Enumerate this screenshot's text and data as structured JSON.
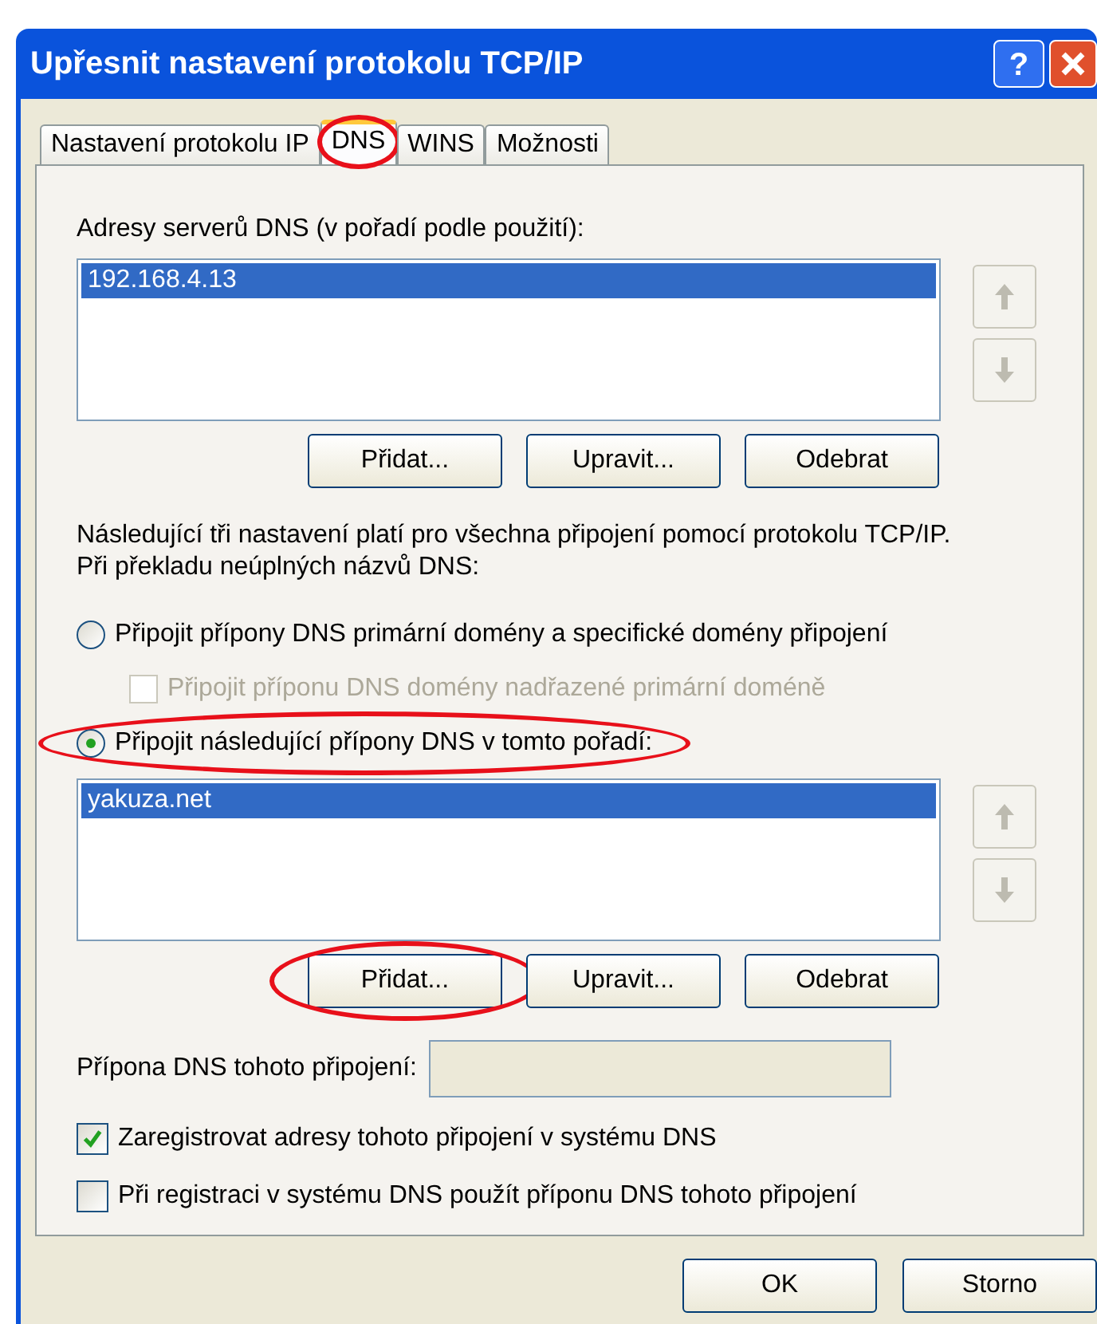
{
  "window": {
    "title": "Upřesnit nastavení protokolu TCP/IP",
    "help_label": "?"
  },
  "tabs": [
    {
      "label": "Nastavení protokolu IP",
      "selected": false,
      "highlighted": false
    },
    {
      "label": "DNS",
      "selected": true,
      "highlighted": true
    },
    {
      "label": "WINS",
      "selected": false,
      "highlighted": false
    },
    {
      "label": "Možnosti",
      "selected": false,
      "highlighted": false
    }
  ],
  "dns_servers": {
    "label": "Adresy serverů DNS (v pořadí podle použití):",
    "items": [
      {
        "text": "192.168.4.13",
        "selected": true
      }
    ],
    "buttons": [
      {
        "label": "Přidat...",
        "highlighted": false
      },
      {
        "label": "Upravit...",
        "highlighted": false
      },
      {
        "label": "Odebrat",
        "highlighted": false
      }
    ]
  },
  "note": "Následující tři nastavení platí pro všechna připojení pomocí protokolu TCP/IP. Při překladu neúplných názvů DNS:",
  "options": [
    {
      "kind": "radio",
      "label": "Připojit přípony DNS primární domény a specifické domény připojení",
      "checked": false,
      "disabled": false,
      "highlighted": false,
      "children": [
        {
          "kind": "checkbox",
          "label": "Připojit příponu DNS domény nadřazené primární doméně",
          "checked": false,
          "disabled": true,
          "highlighted": false
        }
      ]
    },
    {
      "kind": "radio",
      "label": "Připojit následující přípony DNS v tomto pořadí:",
      "checked": true,
      "disabled": false,
      "highlighted": true
    }
  ],
  "suffixes": {
    "items": [
      {
        "text": "yakuza.net",
        "selected": true
      }
    ],
    "buttons": [
      {
        "label": "Přidat...",
        "highlighted": true
      },
      {
        "label": "Upravit...",
        "highlighted": false
      },
      {
        "label": "Odebrat",
        "highlighted": false
      }
    ]
  },
  "suffix_field": {
    "label": "Přípona DNS tohoto připojení:",
    "disabled": true
  },
  "registration": [
    {
      "label": "Zaregistrovat adresy tohoto připojení v systému DNS",
      "checked": true
    },
    {
      "label": "Při registraci v systému DNS použít příponu DNS tohoto připojení",
      "checked": false
    }
  ],
  "footer_buttons": [
    {
      "label": "OK"
    },
    {
      "label": "Storno"
    }
  ]
}
